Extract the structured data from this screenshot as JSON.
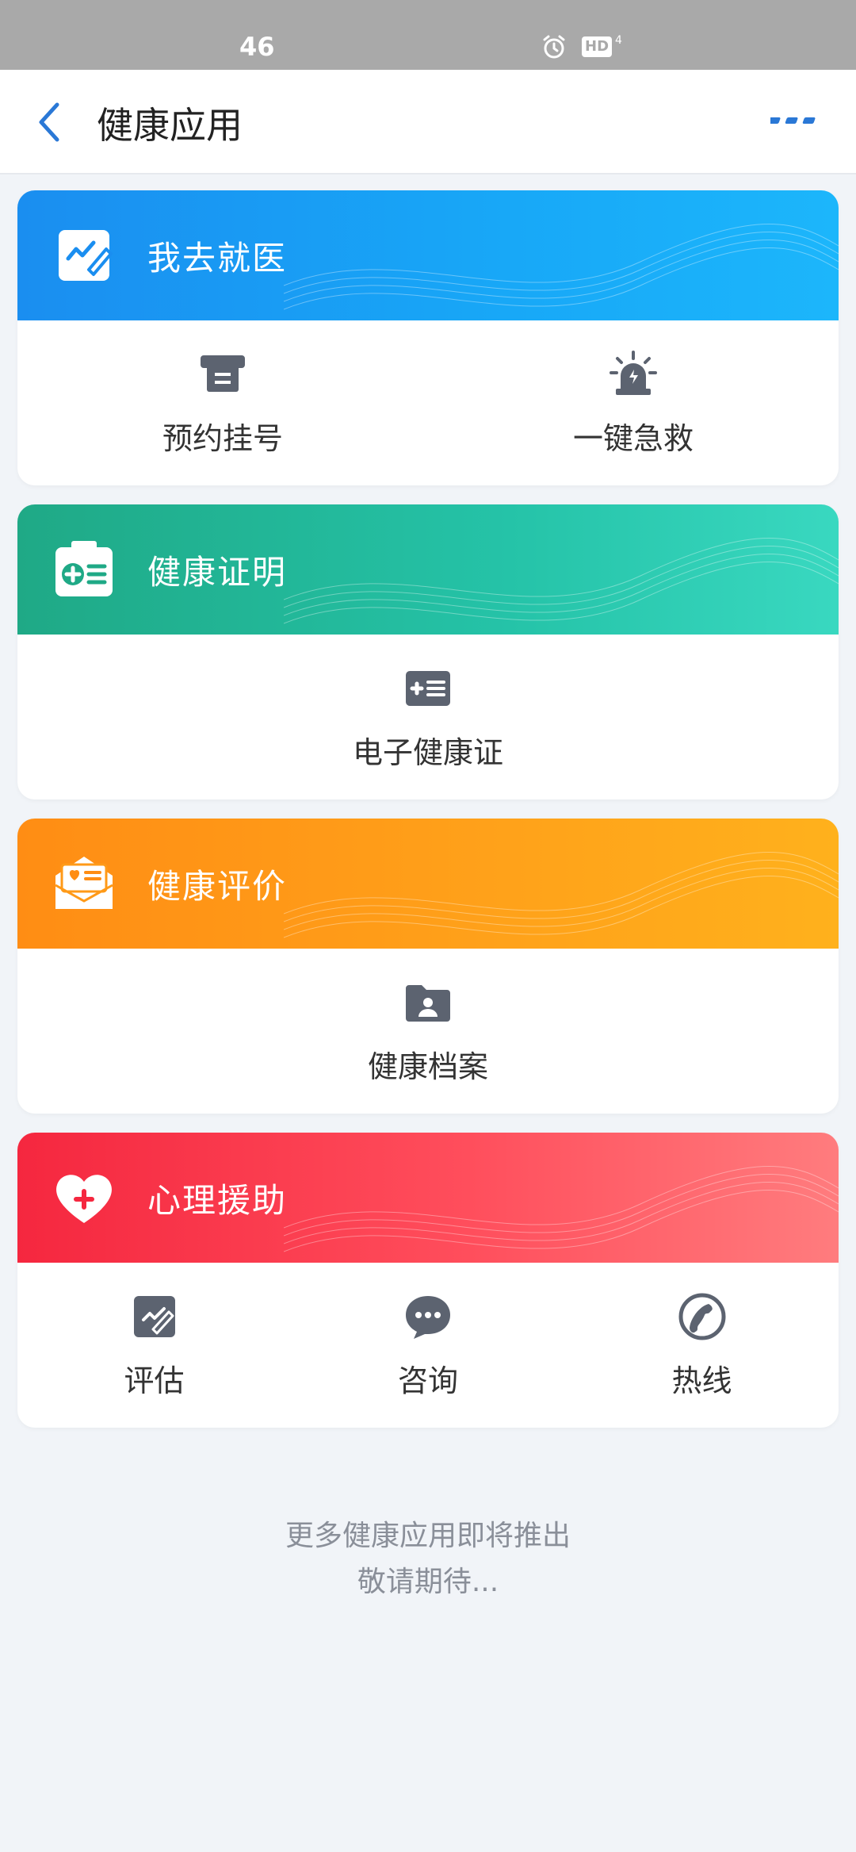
{
  "status_bar": {
    "network": "46",
    "hd_label": "HD",
    "signal_small": "4"
  },
  "header": {
    "title": "健康应用"
  },
  "sections": [
    {
      "title": "我去就医",
      "items": [
        {
          "label": "预约挂号",
          "icon": "ticket-icon"
        },
        {
          "label": "一键急救",
          "icon": "alarm-icon"
        }
      ]
    },
    {
      "title": "健康证明",
      "items": [
        {
          "label": "电子健康证",
          "icon": "health-card-icon"
        }
      ]
    },
    {
      "title": "健康评价",
      "items": [
        {
          "label": "健康档案",
          "icon": "folder-person-icon"
        }
      ]
    },
    {
      "title": "心理援助",
      "items": [
        {
          "label": "评估",
          "icon": "edit-icon"
        },
        {
          "label": "咨询",
          "icon": "chat-icon"
        },
        {
          "label": "热线",
          "icon": "phone-icon"
        }
      ]
    }
  ],
  "footer": {
    "line1": "更多健康应用即将推出",
    "line2": "敬请期待..."
  },
  "colors": {
    "accent": "#1a8ef0",
    "green": "#1fa986",
    "orange": "#ff8d14",
    "red": "#f5273f",
    "icon_gray": "#5c6370"
  }
}
